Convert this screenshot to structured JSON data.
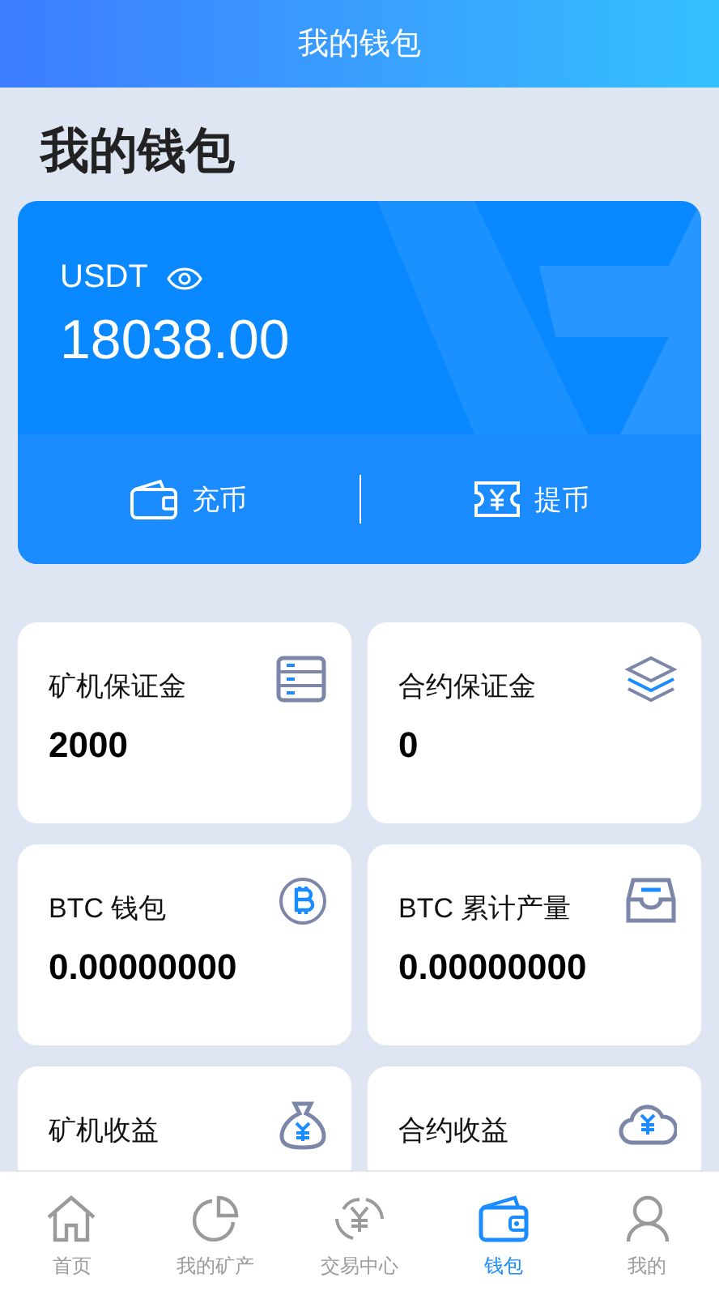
{
  "header": {
    "title": "我的钱包"
  },
  "page_title": "我的钱包",
  "balance": {
    "currency": "USDT",
    "amount": "18038.00",
    "actions": [
      "充币",
      "提币"
    ]
  },
  "cards": [
    {
      "label": "矿机保证金",
      "value": "2000"
    },
    {
      "label": "合约保证金",
      "value": "0"
    },
    {
      "label": "BTC 钱包",
      "value": "0.00000000"
    },
    {
      "label": "BTC 累计产量",
      "value": "0.00000000"
    },
    {
      "label": "矿机收益"
    },
    {
      "label": "合约收益"
    }
  ],
  "tabs": [
    {
      "label": "首页",
      "selected": false
    },
    {
      "label": "我的矿产",
      "selected": false
    },
    {
      "label": "交易中心",
      "selected": false
    },
    {
      "label": "钱包",
      "selected": true
    },
    {
      "label": "我的",
      "selected": false
    }
  ]
}
